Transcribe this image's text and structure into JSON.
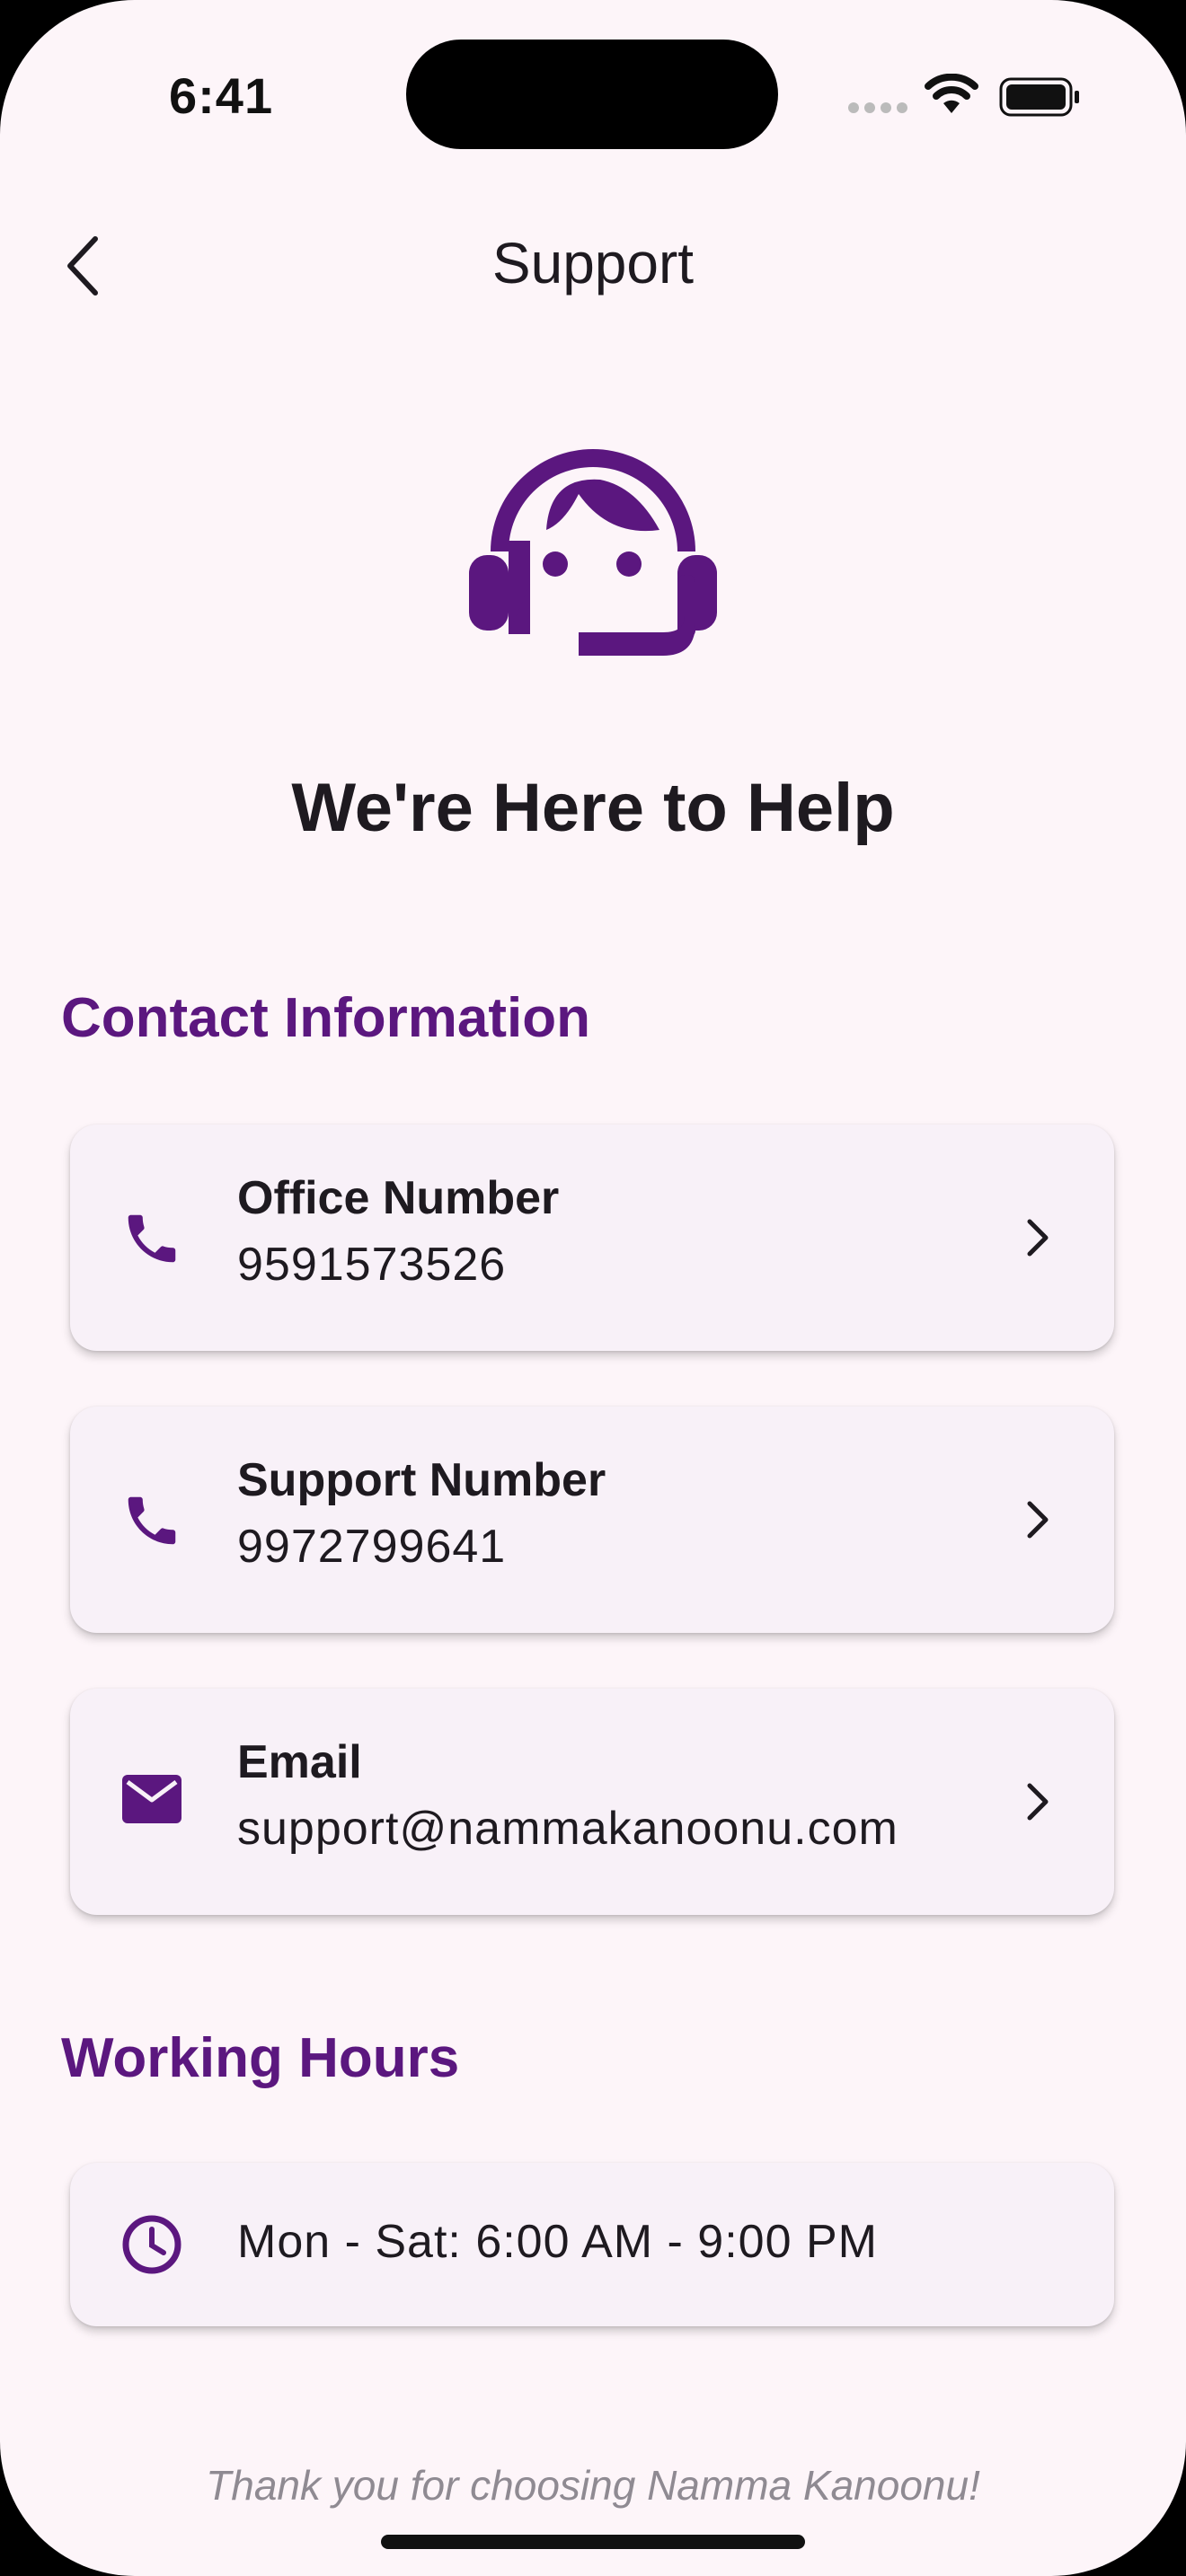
{
  "status_bar": {
    "time": "6:41",
    "icons": [
      "signal-icon",
      "wifi-icon",
      "battery-icon"
    ]
  },
  "nav": {
    "title": "Support",
    "back_icon": "chevron-left-icon"
  },
  "hero": {
    "icon": "support-agent-icon",
    "title": "We're Here to Help"
  },
  "contact": {
    "section_title": "Contact Information",
    "items": [
      {
        "icon": "phone-icon",
        "label": "Office Number",
        "value": "9591573526",
        "action_icon": "chevron-right-icon"
      },
      {
        "icon": "phone-icon",
        "label": "Support Number",
        "value": "9972799641",
        "action_icon": "chevron-right-icon"
      },
      {
        "icon": "email-icon",
        "label": "Email",
        "value": "support@nammakanoonu.com",
        "action_icon": "chevron-right-icon"
      }
    ]
  },
  "hours": {
    "section_title": "Working Hours",
    "icon": "clock-icon",
    "text": "Mon - Sat: 6:00 AM - 9:00 PM"
  },
  "footer": {
    "text": "Thank you for choosing Namma Kanoonu!"
  },
  "colors": {
    "accent": "#5b177f",
    "background": "#fdf5f9",
    "card": "#f8f1f8",
    "text": "#1e1a20",
    "muted": "#8f8a92"
  }
}
